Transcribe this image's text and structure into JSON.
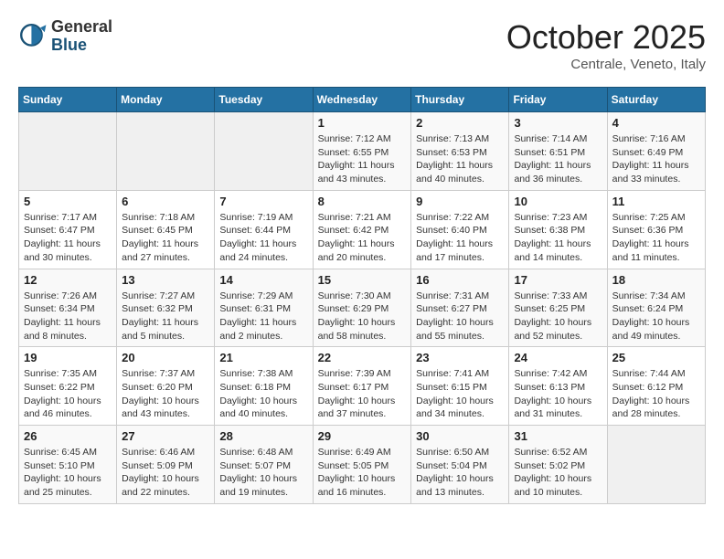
{
  "header": {
    "logo_general": "General",
    "logo_blue": "Blue",
    "month": "October 2025",
    "location": "Centrale, Veneto, Italy"
  },
  "weekdays": [
    "Sunday",
    "Monday",
    "Tuesday",
    "Wednesday",
    "Thursday",
    "Friday",
    "Saturday"
  ],
  "weeks": [
    [
      {
        "day": "",
        "info": ""
      },
      {
        "day": "",
        "info": ""
      },
      {
        "day": "",
        "info": ""
      },
      {
        "day": "1",
        "info": "Sunrise: 7:12 AM\nSunset: 6:55 PM\nDaylight: 11 hours and 43 minutes."
      },
      {
        "day": "2",
        "info": "Sunrise: 7:13 AM\nSunset: 6:53 PM\nDaylight: 11 hours and 40 minutes."
      },
      {
        "day": "3",
        "info": "Sunrise: 7:14 AM\nSunset: 6:51 PM\nDaylight: 11 hours and 36 minutes."
      },
      {
        "day": "4",
        "info": "Sunrise: 7:16 AM\nSunset: 6:49 PM\nDaylight: 11 hours and 33 minutes."
      }
    ],
    [
      {
        "day": "5",
        "info": "Sunrise: 7:17 AM\nSunset: 6:47 PM\nDaylight: 11 hours and 30 minutes."
      },
      {
        "day": "6",
        "info": "Sunrise: 7:18 AM\nSunset: 6:45 PM\nDaylight: 11 hours and 27 minutes."
      },
      {
        "day": "7",
        "info": "Sunrise: 7:19 AM\nSunset: 6:44 PM\nDaylight: 11 hours and 24 minutes."
      },
      {
        "day": "8",
        "info": "Sunrise: 7:21 AM\nSunset: 6:42 PM\nDaylight: 11 hours and 20 minutes."
      },
      {
        "day": "9",
        "info": "Sunrise: 7:22 AM\nSunset: 6:40 PM\nDaylight: 11 hours and 17 minutes."
      },
      {
        "day": "10",
        "info": "Sunrise: 7:23 AM\nSunset: 6:38 PM\nDaylight: 11 hours and 14 minutes."
      },
      {
        "day": "11",
        "info": "Sunrise: 7:25 AM\nSunset: 6:36 PM\nDaylight: 11 hours and 11 minutes."
      }
    ],
    [
      {
        "day": "12",
        "info": "Sunrise: 7:26 AM\nSunset: 6:34 PM\nDaylight: 11 hours and 8 minutes."
      },
      {
        "day": "13",
        "info": "Sunrise: 7:27 AM\nSunset: 6:32 PM\nDaylight: 11 hours and 5 minutes."
      },
      {
        "day": "14",
        "info": "Sunrise: 7:29 AM\nSunset: 6:31 PM\nDaylight: 11 hours and 2 minutes."
      },
      {
        "day": "15",
        "info": "Sunrise: 7:30 AM\nSunset: 6:29 PM\nDaylight: 10 hours and 58 minutes."
      },
      {
        "day": "16",
        "info": "Sunrise: 7:31 AM\nSunset: 6:27 PM\nDaylight: 10 hours and 55 minutes."
      },
      {
        "day": "17",
        "info": "Sunrise: 7:33 AM\nSunset: 6:25 PM\nDaylight: 10 hours and 52 minutes."
      },
      {
        "day": "18",
        "info": "Sunrise: 7:34 AM\nSunset: 6:24 PM\nDaylight: 10 hours and 49 minutes."
      }
    ],
    [
      {
        "day": "19",
        "info": "Sunrise: 7:35 AM\nSunset: 6:22 PM\nDaylight: 10 hours and 46 minutes."
      },
      {
        "day": "20",
        "info": "Sunrise: 7:37 AM\nSunset: 6:20 PM\nDaylight: 10 hours and 43 minutes."
      },
      {
        "day": "21",
        "info": "Sunrise: 7:38 AM\nSunset: 6:18 PM\nDaylight: 10 hours and 40 minutes."
      },
      {
        "day": "22",
        "info": "Sunrise: 7:39 AM\nSunset: 6:17 PM\nDaylight: 10 hours and 37 minutes."
      },
      {
        "day": "23",
        "info": "Sunrise: 7:41 AM\nSunset: 6:15 PM\nDaylight: 10 hours and 34 minutes."
      },
      {
        "day": "24",
        "info": "Sunrise: 7:42 AM\nSunset: 6:13 PM\nDaylight: 10 hours and 31 minutes."
      },
      {
        "day": "25",
        "info": "Sunrise: 7:44 AM\nSunset: 6:12 PM\nDaylight: 10 hours and 28 minutes."
      }
    ],
    [
      {
        "day": "26",
        "info": "Sunrise: 6:45 AM\nSunset: 5:10 PM\nDaylight: 10 hours and 25 minutes."
      },
      {
        "day": "27",
        "info": "Sunrise: 6:46 AM\nSunset: 5:09 PM\nDaylight: 10 hours and 22 minutes."
      },
      {
        "day": "28",
        "info": "Sunrise: 6:48 AM\nSunset: 5:07 PM\nDaylight: 10 hours and 19 minutes."
      },
      {
        "day": "29",
        "info": "Sunrise: 6:49 AM\nSunset: 5:05 PM\nDaylight: 10 hours and 16 minutes."
      },
      {
        "day": "30",
        "info": "Sunrise: 6:50 AM\nSunset: 5:04 PM\nDaylight: 10 hours and 13 minutes."
      },
      {
        "day": "31",
        "info": "Sunrise: 6:52 AM\nSunset: 5:02 PM\nDaylight: 10 hours and 10 minutes."
      },
      {
        "day": "",
        "info": ""
      }
    ]
  ]
}
